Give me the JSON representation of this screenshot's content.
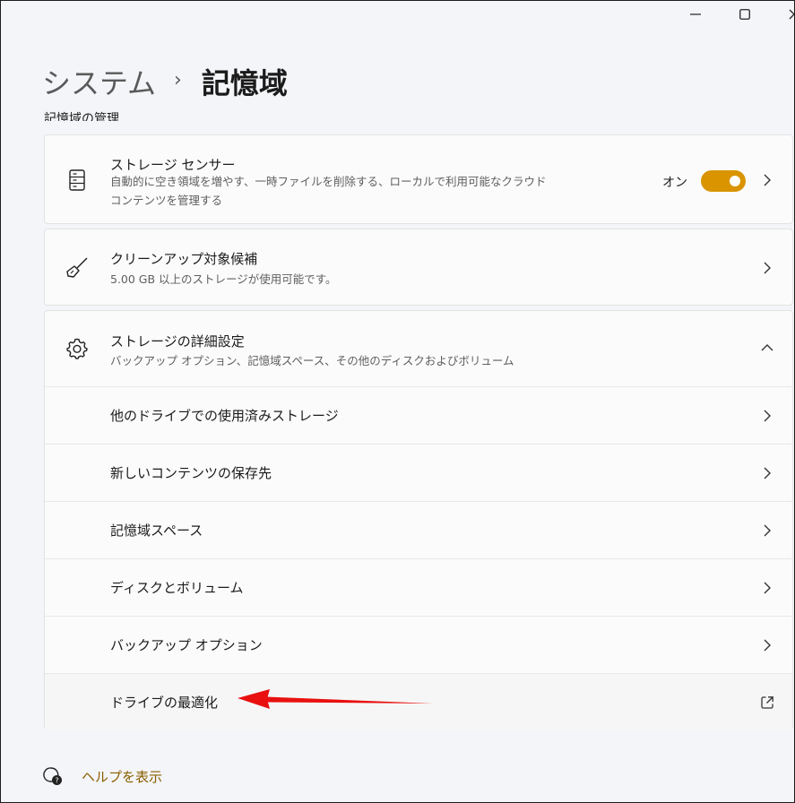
{
  "breadcrumb": {
    "parent": "システム",
    "separator": "›",
    "current": "記憶域"
  },
  "section_title": "記憶域の管理",
  "storage_sense": {
    "title": "ストレージ センサー",
    "description": "自動的に空き領域を増やす、一時ファイルを削除する、ローカルで利用可能なクラウド コンテンツを管理する",
    "toggle_label": "オン",
    "toggle_on": true,
    "icon": "storage-drive-icon"
  },
  "cleanup": {
    "title": "クリーンアップ対象候補",
    "description": "5.00 GB 以上のストレージが使用可能です。",
    "icon": "broom-icon"
  },
  "advanced": {
    "title": "ストレージの詳細設定",
    "description": "バックアップ オプション、記憶域スペース、その他のディスクおよびボリューム",
    "icon": "gear-icon",
    "items": [
      {
        "label": "他のドライブでの使用済みストレージ"
      },
      {
        "label": "新しいコンテンツの保存先"
      },
      {
        "label": "記憶域スペース"
      },
      {
        "label": "ディスクとボリューム"
      },
      {
        "label": "バックアップ オプション"
      },
      {
        "label": "ドライブの最適化"
      }
    ]
  },
  "help": {
    "label": "ヘルプを表示",
    "icon": "help-icon"
  },
  "colors": {
    "accent": "#d99400",
    "annotation_arrow": "#e8110f",
    "link": "#8b5e00"
  }
}
